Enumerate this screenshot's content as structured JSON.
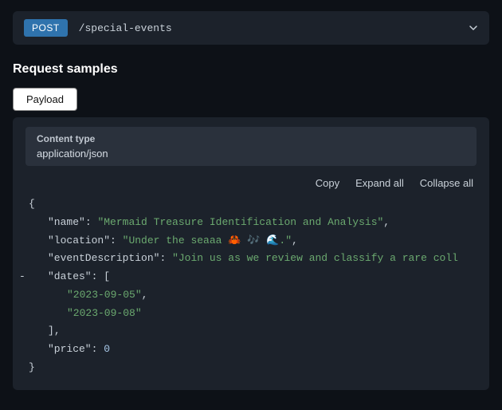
{
  "endpoint": {
    "method": "POST",
    "path": "/special-events"
  },
  "section_title": "Request samples",
  "tab_label": "Payload",
  "content_type": {
    "label": "Content type",
    "value": "application/json"
  },
  "actions": {
    "copy": "Copy",
    "expand": "Expand all",
    "collapse": "Collapse all"
  },
  "code": {
    "open_brace": "{",
    "close_brace": "}",
    "keys": {
      "name": "\"name\"",
      "location": "\"location\"",
      "eventDescription": "\"eventDescription\"",
      "dates": "\"dates\"",
      "price": "\"price\""
    },
    "values": {
      "name": "\"Mermaid Treasure Identification and Analysis\"",
      "location": "\"Under the seaaa 🦀 🎶 🌊.\"",
      "eventDescription": "\"Join us as we review and classify a rare coll",
      "date1": "\"2023-09-05\"",
      "date2": "\"2023-09-08\"",
      "price": "0"
    },
    "arr_open": "[",
    "arr_close": "]",
    "colon": ":",
    "comma": ",",
    "collapse_marker": "-"
  }
}
